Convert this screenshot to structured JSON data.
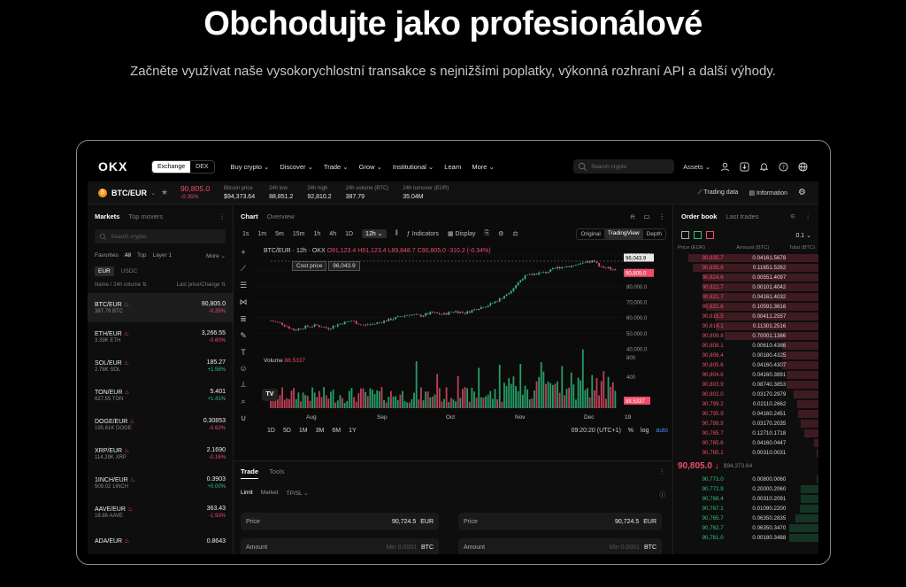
{
  "hero": {
    "title": "Obchodujte jako profesionálové",
    "subtitle": "Začněte využívat naše vysokorychlostní transakce s nejnižšími poplatky, výkonná rozhraní API a další výhody."
  },
  "nav": {
    "logo": "OKX",
    "segments": [
      "Exchange",
      "DEX"
    ],
    "items": [
      "Buy crypto ⌄",
      "Discover ⌄",
      "Trade ⌄",
      "Grow ⌄",
      "Institutional ⌄",
      "Learn",
      "More ⌄"
    ],
    "search_placeholder": "Search crypto",
    "assets": "Assets ⌄"
  },
  "ticker": {
    "pair": "BTC/EUR",
    "price": "90,805.0",
    "change": "-0.35%",
    "stats": [
      {
        "label": "Bitcoin price",
        "value": "$94,373.64"
      },
      {
        "label": "24h low",
        "value": "88,851.2"
      },
      {
        "label": "24h high",
        "value": "92,810.2"
      },
      {
        "label": "24h volume (BTC)",
        "value": "387.79"
      },
      {
        "label": "24h turnover (EUR)",
        "value": "35.04M"
      }
    ],
    "trading_data": "Trading data",
    "information": "Information"
  },
  "markets": {
    "tabs": [
      "Markets",
      "Top movers"
    ],
    "search_placeholder": "Search crypto",
    "filters": [
      "Favorites",
      "All",
      "Top",
      "Layer 1",
      "More ⌄"
    ],
    "quotes": [
      "EUR",
      "USDC"
    ],
    "head_left": "Name / 24h volume ⇅",
    "head_right": "Last price/Change ⇅",
    "rows": [
      {
        "name": "BTC/EUR",
        "sub": "387.79 BTC",
        "price": "90,805.0",
        "change": "-0.35%",
        "dir": "down"
      },
      {
        "name": "ETH/EUR",
        "sub": "3.39K ETH",
        "price": "3,266.55",
        "change": "-0.60%",
        "dir": "down"
      },
      {
        "name": "SOL/EUR",
        "sub": "2.78K SOL",
        "price": "185.27",
        "change": "+1.56%",
        "dir": "up"
      },
      {
        "name": "TON/EUR",
        "sub": "627.55 TON",
        "price": "5.401",
        "change": "+1.41%",
        "dir": "up"
      },
      {
        "name": "DOGE/EUR",
        "sub": "195.61K DOGE",
        "price": "0.30853",
        "change": "-0.62%",
        "dir": "down"
      },
      {
        "name": "XRP/EUR",
        "sub": "114.29K XRP",
        "price": "2.1690",
        "change": "-0.16%",
        "dir": "down"
      },
      {
        "name": "1INCH/EUR",
        "sub": "509.02 1INCH",
        "price": "0.3903",
        "change": "+0.00%",
        "dir": "up"
      },
      {
        "name": "AAVE/EUR",
        "sub": "18.86 AAVE",
        "price": "363.43",
        "change": "-1.93%",
        "dir": "down"
      },
      {
        "name": "ADA/EUR",
        "sub": "",
        "price": "0.8643",
        "change": "",
        "dir": "up"
      }
    ]
  },
  "chart": {
    "tabs": [
      "Chart",
      "Overview"
    ],
    "intervals": [
      "1s",
      "1m",
      "5m",
      "15m",
      "1h",
      "4h",
      "1D",
      "12h ⌄"
    ],
    "indicators": "Indicators",
    "display": "Display",
    "views": [
      "Original",
      "TradingView",
      "Depth"
    ],
    "legend_prefix": "BTC/EUR · 12h · OKX",
    "legend_o": "O91,123.4",
    "legend_h": "H91,123.4",
    "legend_l": "L89,848.7",
    "legend_c": "C90,805.0",
    "legend_chg": "-310.2 (-0.34%)",
    "cost_price_label": "Cost price",
    "cost_price_value": "96,043.9",
    "volume_label": "Volume",
    "volume_value": "88.5337",
    "ranges": [
      "1D",
      "5D",
      "1M",
      "3M",
      "6M",
      "1Y"
    ],
    "clock": "09:20:20 (UTC+1)",
    "scale_opts": [
      "%",
      "log",
      "auto"
    ],
    "tv": "TV",
    "price_ticks": [
      "100,000.0",
      "90,000.0",
      "80,000.0",
      "70,000.0",
      "60,000.0",
      "50,000.0",
      "40,000.0"
    ],
    "price_badges": [
      "96,043.9",
      "90,805.0"
    ],
    "volume_ticks": [
      "800",
      "400"
    ],
    "volume_badge": "88.5337",
    "date_ticks": [
      "Aug",
      "Sep",
      "Oct",
      "Nov",
      "Dec",
      "19"
    ]
  },
  "chart_data": {
    "type": "candlestick",
    "title": "BTC/EUR · 12h · OKX",
    "ylim": [
      40000,
      100000
    ],
    "x_labels": [
      "Aug",
      "Sep",
      "Oct",
      "Nov",
      "Dec",
      "19"
    ],
    "series": [
      {
        "name": "Price",
        "close_trend": [
          58000,
          56000,
          52000,
          54000,
          55000,
          53000,
          56000,
          58000,
          55000,
          56000,
          58000,
          60000,
          62000,
          61000,
          63000,
          62000,
          64000,
          63000,
          66000,
          68000,
          72000,
          78000,
          86000,
          88000,
          89000,
          92000,
          93000,
          94000,
          96000,
          92000,
          90805
        ]
      },
      {
        "name": "Volume"
      }
    ]
  },
  "trade": {
    "tabs": [
      "Trade",
      "Tools"
    ],
    "order_types": [
      "Limit",
      "Market",
      "TP/SL ⌄"
    ],
    "price_label": "Price",
    "price_value": "90,724.5",
    "price_unit": "EUR",
    "amount_label": "Amount",
    "amount_ph": "Min 0.0001",
    "amount_unit": "BTC"
  },
  "book": {
    "tabs": [
      "Order book",
      "Last trades"
    ],
    "precision": "0.1 ⌄",
    "headers": [
      "Price (EUR)",
      "Amount (BTC)",
      "Total (BTC)"
    ],
    "asks": [
      [
        "90,835.7",
        "0.0416",
        "1.5678",
        0.9
      ],
      [
        "90,835.6",
        "0.1165",
        "1.5262",
        0.87
      ],
      [
        "90,824.6",
        "0.0055",
        "1.4097",
        0.8
      ],
      [
        "90,822.7",
        "0.0010",
        "1.4042",
        0.8
      ],
      [
        "90,821.7",
        "0.0416",
        "1.4032",
        0.8
      ],
      [
        "90,821.6",
        "0.1059",
        "1.3616",
        0.78
      ],
      [
        "90,815.5",
        "0.0041",
        "1.2557",
        0.72
      ],
      [
        "90,814.1",
        "0.1130",
        "1.2516",
        0.71
      ],
      [
        "90,809.8",
        "0.7000",
        "1.1386",
        0.65
      ],
      [
        "90,808.1",
        "0.0061",
        "0.4386",
        0.25
      ],
      [
        "90,806.4",
        "0.0018",
        "0.4325",
        0.25
      ],
      [
        "90,805.6",
        "0.0416",
        "0.4307",
        0.25
      ],
      [
        "90,804.8",
        "0.0416",
        "0.3891",
        0.22
      ],
      [
        "90,803.9",
        "0.0874",
        "0.3853",
        0.22
      ],
      [
        "90,802.0",
        "0.0317",
        "0.2979",
        0.17
      ],
      [
        "90,799.2",
        "0.0211",
        "0.2662",
        0.15
      ],
      [
        "90,795.9",
        "0.0416",
        "0.2451",
        0.14
      ],
      [
        "90,789.9",
        "0.0317",
        "0.2035",
        0.12
      ],
      [
        "90,785.7",
        "0.1271",
        "0.1718",
        0.1
      ],
      [
        "90,785.6",
        "0.0416",
        "0.0447",
        0.03
      ],
      [
        "90,785.1",
        "0.0031",
        "0.0031",
        0.01
      ]
    ],
    "mid_price": "90,805.0 ↓",
    "mid_usd": "$94,373.64",
    "bids": [
      [
        "90,773.0",
        "0.0080",
        "0.0060",
        0.01
      ],
      [
        "90,772.9",
        "0.2000",
        "0.2060",
        0.12
      ],
      [
        "90,768.4",
        "0.0031",
        "0.2091",
        0.12
      ],
      [
        "90,767.1",
        "0.0109",
        "0.2200",
        0.13
      ],
      [
        "90,765.7",
        "0.0635",
        "0.2835",
        0.16
      ],
      [
        "90,762.7",
        "0.0635",
        "0.3470",
        0.2
      ],
      [
        "90,761.0",
        "0.0018",
        "0.3488",
        0.2
      ]
    ]
  }
}
